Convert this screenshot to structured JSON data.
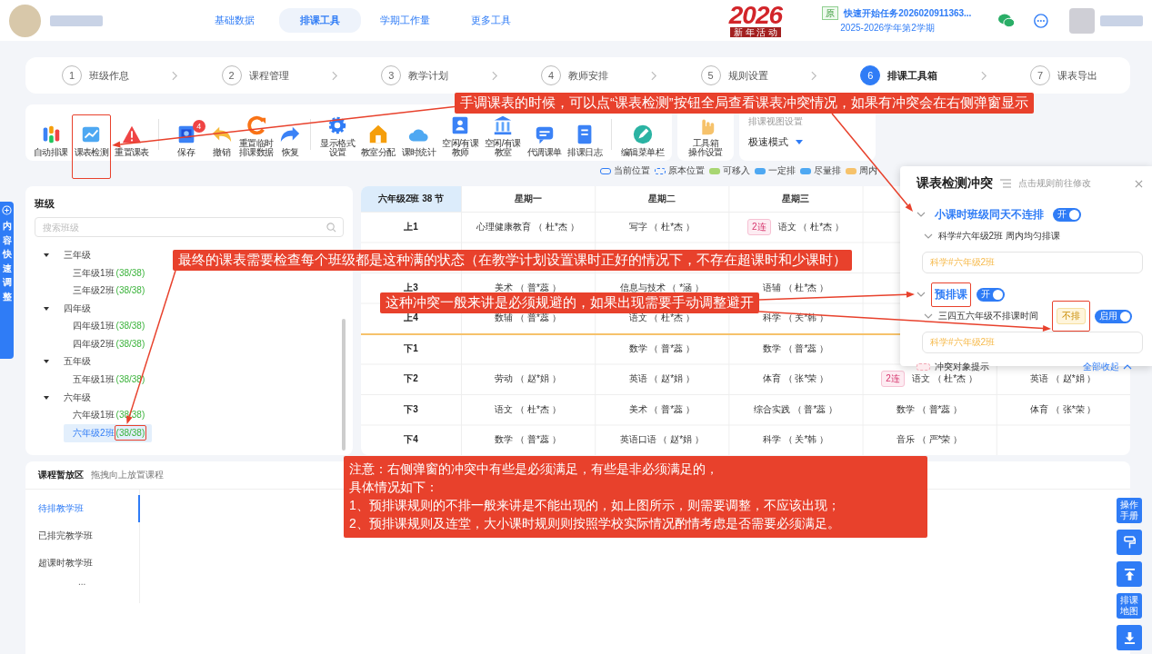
{
  "header": {
    "nav": [
      {
        "label": "基础数据",
        "selected": false
      },
      {
        "label": "排课工具",
        "selected": true
      },
      {
        "label": "学期工作量",
        "selected": false
      },
      {
        "label": "更多工具",
        "selected": false
      }
    ],
    "logo": {
      "year": "2026",
      "caption": "新 年 活 动"
    },
    "task": {
      "badge": "原",
      "title": "快速开始任务2026020911363...",
      "term": "2025-2026学年第2学期"
    }
  },
  "steps": [
    {
      "number": "1",
      "label": "班级作息",
      "selected": false
    },
    {
      "number": "2",
      "label": "课程管理",
      "selected": false
    },
    {
      "number": "3",
      "label": "教学计划",
      "selected": false
    },
    {
      "number": "4",
      "label": "教师安排",
      "selected": false
    },
    {
      "number": "5",
      "label": "规则设置",
      "selected": false
    },
    {
      "number": "6",
      "label": "排课工具箱",
      "selected": true
    },
    {
      "number": "7",
      "label": "课表导出",
      "selected": false
    }
  ],
  "tool_groups": [
    [
      {
        "lines": [
          "自动排课"
        ]
      },
      {
        "lines": [
          "课表检测"
        ]
      },
      {
        "lines": [
          "重置课表"
        ]
      }
    ],
    [
      {
        "lines": [
          "保存"
        ],
        "badge": "4"
      },
      {
        "lines": [
          "撤销"
        ]
      },
      {
        "lines": [
          "重置临时",
          "排课数据"
        ]
      },
      {
        "lines": [
          "恢复"
        ]
      }
    ],
    [
      {
        "lines": [
          "显示格式",
          "设置"
        ]
      },
      {
        "lines": [
          "教室分配"
        ]
      },
      {
        "lines": [
          "课时统计"
        ]
      },
      {
        "lines": [
          "空闲/有课",
          "教师"
        ]
      },
      {
        "lines": [
          "空闲/有课",
          "教室"
        ]
      },
      {
        "lines": [
          "代调课单"
        ]
      },
      {
        "lines": [
          "排课日志"
        ]
      }
    ],
    [
      {
        "lines": [
          "编辑菜单栏"
        ]
      }
    ]
  ],
  "tool_settings": {
    "lines": [
      "工具箱",
      "操作设置"
    ]
  },
  "view_settings": {
    "title": "排课视图设置",
    "mode": "极速模式"
  },
  "legend": [
    {
      "label": "当前位置",
      "kind": "outline",
      "color": "#2f7cf6"
    },
    {
      "label": "原本位置",
      "kind": "dashed",
      "color": "#2f7cf6"
    },
    {
      "label": "可移入",
      "kind": "fill",
      "color": "#a8d672"
    },
    {
      "label": "一定排",
      "kind": "fill",
      "color": "#4ea8f2"
    },
    {
      "label": "尽量排",
      "kind": "fill",
      "color": "#4ea8f2"
    },
    {
      "label": "周内",
      "kind": "fill",
      "color": "#f6c26b"
    }
  ],
  "side_tab": {
    "label": "内容快速调整"
  },
  "class_panel": {
    "title": "班级",
    "search": {
      "placeholder": "搜索班级"
    },
    "tree": [
      {
        "label": "三年级",
        "expanded": true,
        "children": [
          {
            "label": "三年级1班",
            "count": "(38/38)",
            "selected": false
          },
          {
            "label": "三年级2班",
            "count": "(38/38)",
            "selected": false
          }
        ]
      },
      {
        "label": "四年级",
        "expanded": true,
        "children": [
          {
            "label": "四年级1班",
            "count": "(38/38)",
            "selected": false
          },
          {
            "label": "四年级2班",
            "count": "(38/38)",
            "selected": false
          }
        ]
      },
      {
        "label": "五年级",
        "expanded": true,
        "children": [
          {
            "label": "五年级1班",
            "count": "(38/38)",
            "selected": false
          }
        ]
      },
      {
        "label": "六年级",
        "expanded": true,
        "children": [
          {
            "label": "六年级1班",
            "count": "(38/38)",
            "selected": false
          },
          {
            "label": "六年级2班",
            "count": "(38/38)",
            "selected": true
          }
        ]
      }
    ]
  },
  "timetable": {
    "corner": "六年级2班 38 节",
    "days": [
      "星期一",
      "星期二",
      "星期三"
    ],
    "rows": [
      {
        "period": "上1",
        "pm_start": false,
        "cells": [
          {
            "text": "心理健康教育 （ 杜*杰 ）"
          },
          {
            "text": "写字 （ 杜*杰 ）"
          },
          {
            "tag": "2连",
            "text": "语文 （ 杜*杰 ）"
          },
          null,
          null
        ]
      },
      {
        "pm_start": false,
        "cells": [
          null,
          null,
          null,
          null,
          null
        ]
      },
      {
        "period": "上3",
        "pm_start": false,
        "cells": [
          {
            "text": "美术 （ 普*蕊 ）"
          },
          {
            "text": "信息与技术 （ *涵 ）"
          },
          {
            "text": "语辅 （ 杜*杰 ）"
          },
          null,
          null
        ]
      },
      {
        "period": "上4",
        "pm_start": false,
        "cells": [
          {
            "text": "数辅 （ 普*蕊 ）"
          },
          {
            "text": "语文 （ 杜*杰 ）"
          },
          {
            "text": "科学 （ 关*韩 ）"
          },
          null,
          null
        ]
      },
      {
        "period": "下1",
        "pm_start": true,
        "cells": [
          null,
          {
            "text": "数学 （ 普*蕊 ）"
          },
          {
            "text": "数学 （ 普*蕊 ）"
          },
          null,
          null
        ]
      },
      {
        "period": "下2",
        "pm_start": false,
        "cells": [
          {
            "text": "劳动 （ 赵*娟 ）"
          },
          {
            "text": "英语 （ 赵*娟 ）"
          },
          {
            "text": "体育 （ 张*荣 ）"
          },
          {
            "tag": "2连",
            "text": "语文 （ 杜*杰 ）"
          },
          {
            "text": "英语 （ 赵*娟 ）"
          }
        ]
      },
      {
        "period": "下3",
        "pm_start": false,
        "cells": [
          {
            "text": "语文 （ 杜*杰 ）"
          },
          {
            "text": "美术 （ 普*蕊 ）"
          },
          {
            "text": "综合实践 （ 普*蕊 ）"
          },
          {
            "text": "数学 （ 普*蕊 ）"
          },
          {
            "text": "体育 （ 张*荣 ）"
          }
        ]
      },
      {
        "period": "下4",
        "pm_start": false,
        "cells": [
          {
            "text": "数学 （ 普*蕊 ）"
          },
          {
            "text": "英语口语 （ 赵*娟 ）"
          },
          {
            "text": "科学 （ 关*韩 ）"
          },
          {
            "text": "音乐 （ 严*荣 ）"
          },
          null
        ]
      }
    ]
  },
  "holding_area": {
    "title": "课程暂放区",
    "hint": "拖拽向上放置课程",
    "tabs": [
      {
        "label": "待排教学班",
        "selected": true
      },
      {
        "label": "已排完教学班",
        "selected": false
      },
      {
        "label": "超课时教学班",
        "selected": false
      }
    ],
    "more": "..."
  },
  "float_buttons": [
    {
      "lines": [
        "操作",
        "手册"
      ]
    },
    {
      "lines": [
        "排课",
        "地图"
      ]
    }
  ],
  "conflict_popup": {
    "title": "课表检测冲突",
    "hint": "点击规则前往修改",
    "rules": [
      {
        "label": "小课时班级同天不连排",
        "toggle": "开",
        "on": true,
        "expanded": true,
        "children": [
          {
            "label": "科学#六年级2班 周内均匀排课",
            "expanded": true,
            "target": "科学#六年级2班"
          }
        ]
      },
      {
        "label": "预排课",
        "toggle": "开",
        "on": true,
        "expanded": true,
        "children": [
          {
            "label": "三四五六年级不排课时间",
            "tag": "不排",
            "toggle": "启用",
            "on": true,
            "expanded": true,
            "target": "科学#六年级2班"
          }
        ]
      }
    ],
    "legend": "冲突对象提示",
    "collapse_all": "全部收起"
  },
  "annotations": [
    {
      "kind": "callout",
      "lines": [
        "手调课表的时候，可以点“课表检测”按钮全局查看课表冲突情况，如果有冲突会在右侧弹窗显示"
      ]
    },
    {
      "kind": "callout",
      "lines": [
        "最终的课表需要检查每个班级都是这种满的状态（在教学计划设置课时正好的情况下，不存在超课时和少课时）"
      ]
    },
    {
      "kind": "callout",
      "lines": [
        "这种冲突一般来讲是必须规避的，如果出现需要手动调整避开"
      ]
    },
    {
      "kind": "note",
      "lines": [
        "注意：右侧弹窗的冲突中有些是必须满足，有些是非必须满足的，",
        "具体情况如下：",
        "1、预排课规则的不排一般来讲是不能出现的，如上图所示，则需要调整，不应该出现；",
        "2、预排课规则及连堂，大小课时规则则按照学校实际情况酌情考虑是否需要必须满足。"
      ]
    }
  ]
}
